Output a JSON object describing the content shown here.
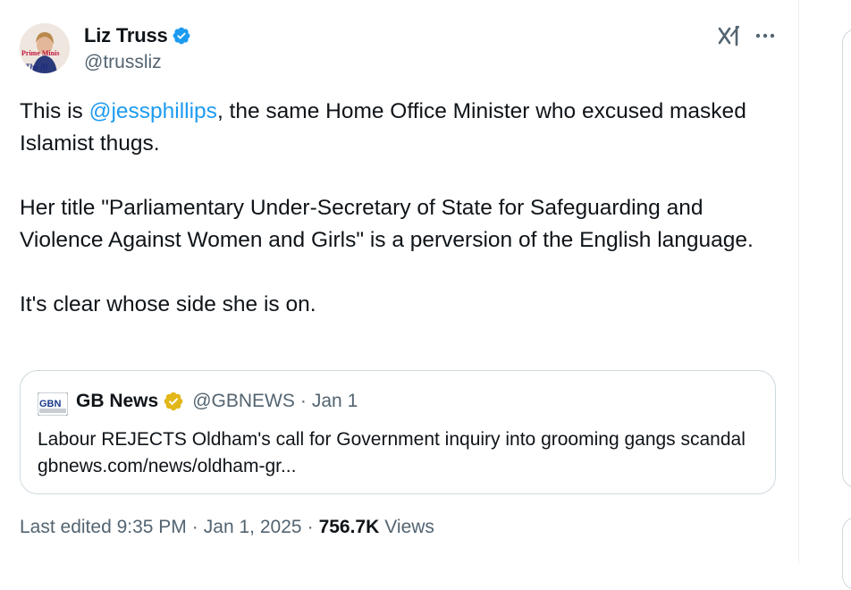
{
  "author": {
    "name": "Liz Truss",
    "handle": "@trussliz",
    "avatar_text_top": "Prime Minis",
    "avatar_text_bottom": "The Bl"
  },
  "tweet": {
    "line1_pre": "This is ",
    "line1_mention": "@jessphillips",
    "line1_post": ", the same Home Office Minister who excused masked Islamist thugs.",
    "para2": "Her title \"Parliamentary Under-Secretary of State for Safeguarding and Violence Against Women and Girls\" is a perversion of the English language.",
    "para3": "It's clear whose side she is on."
  },
  "quote": {
    "logo_text": "GBN",
    "name": "GB News",
    "handle": "@GBNEWS",
    "separator": "·",
    "date": "Jan 1",
    "text": "Labour REJECTS Oldham's call for Government inquiry into grooming gangs scandal gbnews.com/news/oldham-gr..."
  },
  "meta": {
    "edited": "Last edited 9:35 PM",
    "date": "Jan 1, 2025",
    "views_count": "756.7K",
    "views_label": "Views",
    "dot": "·"
  },
  "colors": {
    "accent": "#1d9bf0",
    "secondary_text": "#536471",
    "border": "#cfd9de",
    "gold_badge": "#e2b719"
  },
  "icons": {
    "verified": "verified-badge-icon",
    "grok": "grok-icon",
    "more": "more-icon",
    "gold_verified": "gold-verified-badge-icon"
  }
}
